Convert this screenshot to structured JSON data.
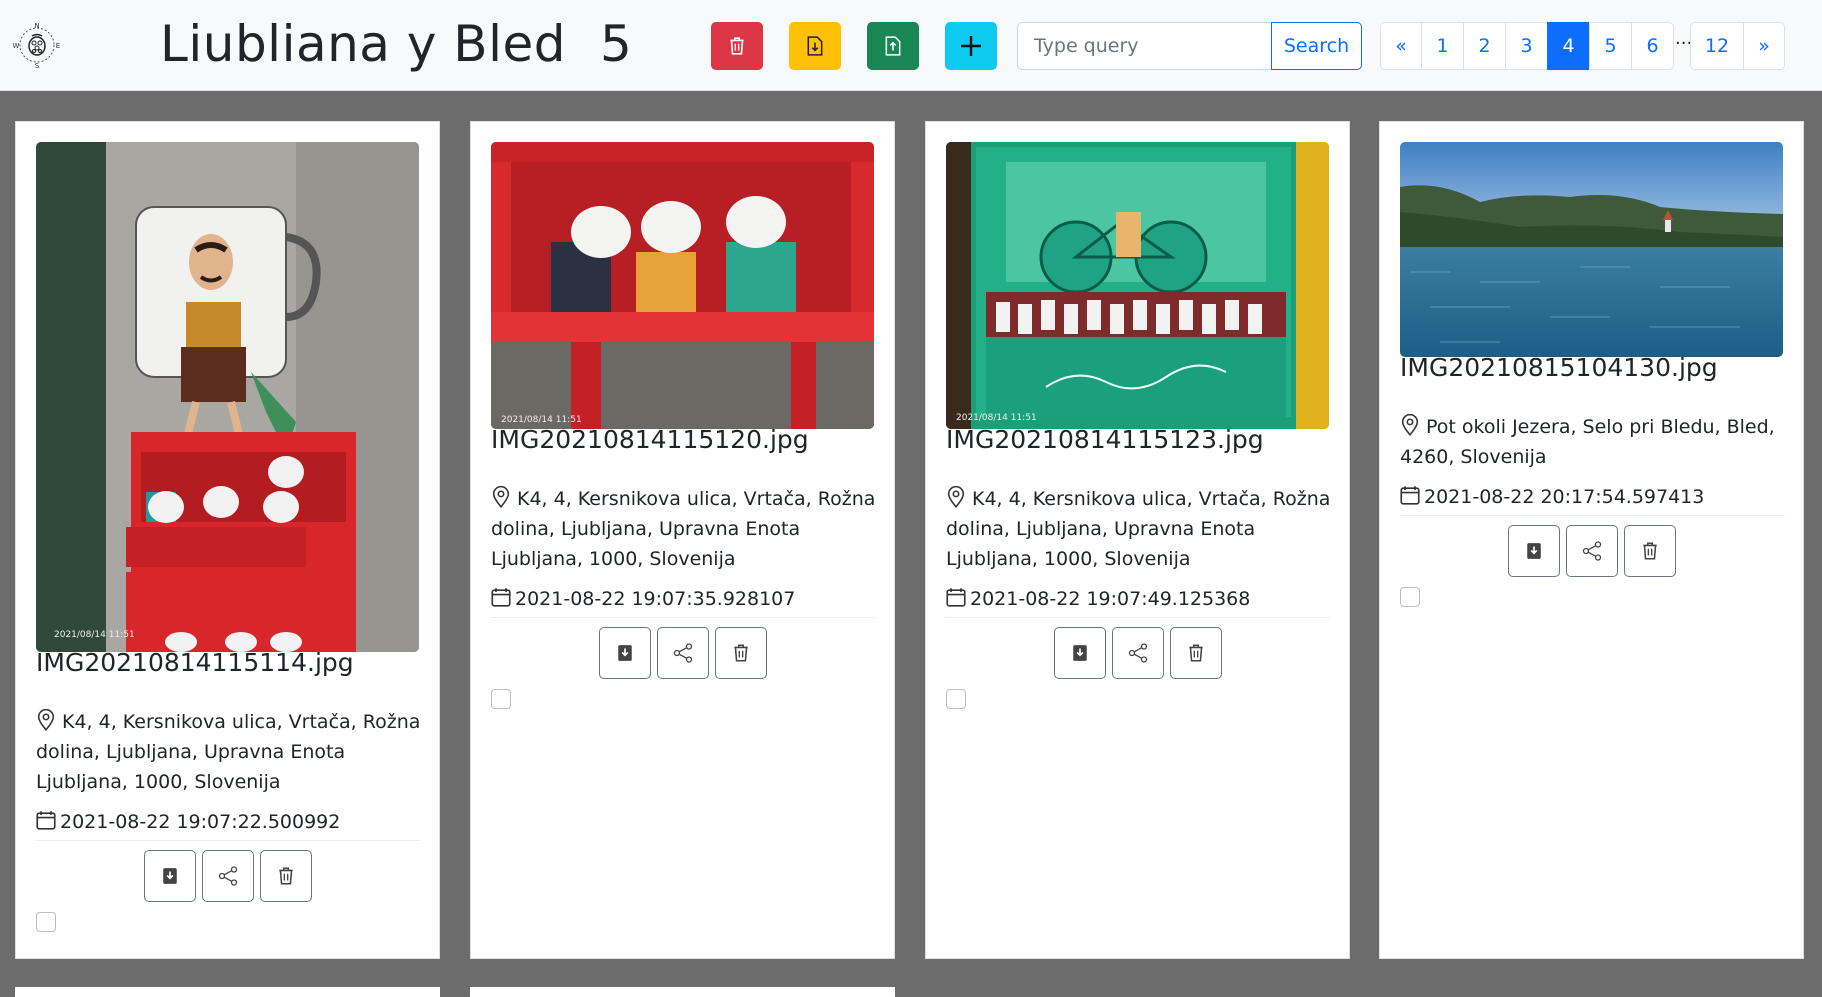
{
  "header": {
    "album_title": "Liubliana y Bled",
    "photo_count": "5",
    "search_placeholder": "Type query",
    "search_label": "Search"
  },
  "toolbar": {
    "delete_icon": "trash-icon",
    "download_icon": "file-download-icon",
    "upload_icon": "file-upload-icon",
    "add_icon": "plus-icon"
  },
  "pagination": {
    "prev": "«",
    "pages": [
      "1",
      "2",
      "3",
      "4",
      "5",
      "6"
    ],
    "ellipsis": "...",
    "last": "12",
    "next": "»",
    "active": "4"
  },
  "photos": [
    {
      "filename": "IMG20210814115114.jpg",
      "location": "K4, 4, Kersnikova ulica, Vrtača, Rožna dolina, Ljubljana, Upravna Enota Ljubljana, 1000, Slovenija",
      "date": "2021-08-22 19:07:22.500992",
      "stamp": "2021/08/14 11:51"
    },
    {
      "filename": "IMG20210814115120.jpg",
      "location": "K4, 4, Kersnikova ulica, Vrtača, Rožna dolina, Ljubljana, Upravna Enota Ljubljana, 1000, Slovenija",
      "date": "2021-08-22 19:07:35.928107",
      "stamp": "2021/08/14 11:51"
    },
    {
      "filename": "IMG20210814115123.jpg",
      "location": "K4, 4, Kersnikova ulica, Vrtača, Rožna dolina, Ljubljana, Upravna Enota Ljubljana, 1000, Slovenija",
      "date": "2021-08-22 19:07:49.125368",
      "stamp": "2021/08/14 11:51"
    },
    {
      "filename": "IMG20210815104130.jpg",
      "location": "Pot okoli Jezera, Selo pri Bledu, Bled, 4260, Slovenija",
      "date": "2021-08-22 20:17:54.597413"
    }
  ],
  "colors": {
    "danger": "#dc3545",
    "warning": "#ffc107",
    "success": "#198754",
    "info": "#0dcaf0",
    "primary": "#0d6efd"
  }
}
